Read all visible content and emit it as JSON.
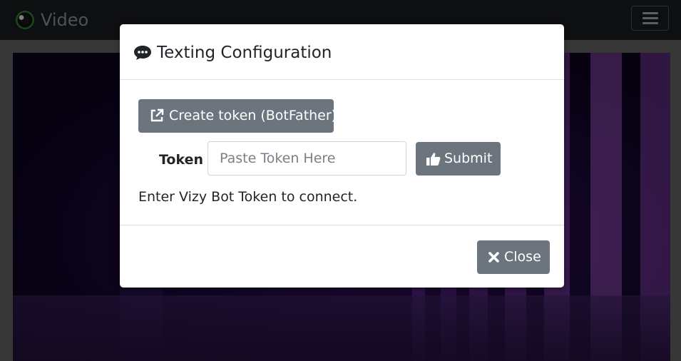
{
  "navbar": {
    "title": "Video",
    "logo_icon": "vizy-eye-logo",
    "menu_icon": "hamburger-menu-icon"
  },
  "modal": {
    "title": "Texting Configuration",
    "title_icon": "chat-bubble-icon",
    "create_token_button": {
      "label": "Create token (BotFather)",
      "icon": "external-link-icon"
    },
    "token_label": "Token",
    "token_input": {
      "value": "",
      "placeholder": "Paste Token Here"
    },
    "submit_button": {
      "label": "Submit",
      "icon": "thumbs-up-icon"
    },
    "help_text": "Enter Vizy Bot Token to connect.",
    "close_button": {
      "label": "Close",
      "icon": "close-x-icon"
    }
  },
  "colors": {
    "navbar_bg": "#1c1e20",
    "button_secondary": "#6c757d",
    "modal_bg": "#ffffff",
    "logo_ring": "#5cb85c"
  }
}
